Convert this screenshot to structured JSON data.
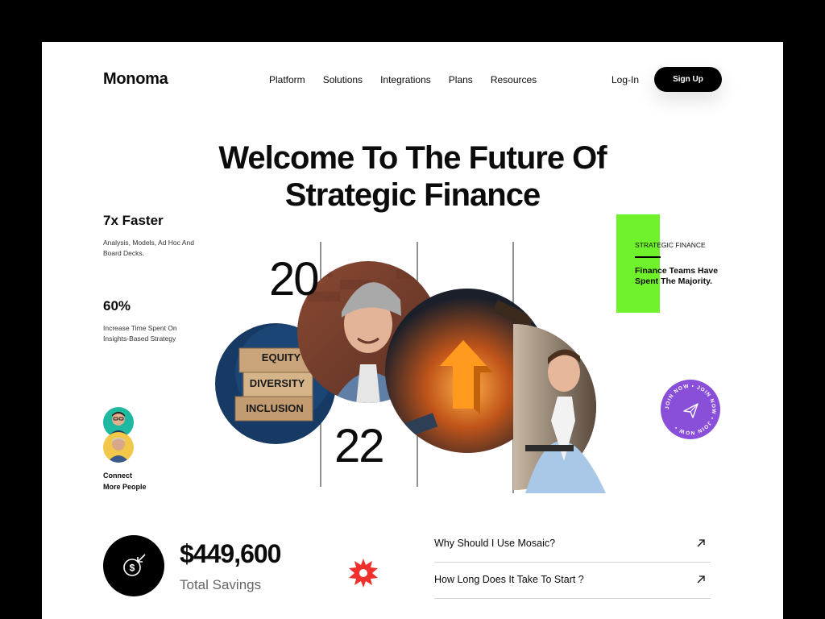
{
  "header": {
    "logo": "Monoma",
    "nav": [
      "Platform",
      "Solutions",
      "Integrations",
      "Plans",
      "Resources"
    ],
    "login": "Log-In",
    "signup": "Sign Up"
  },
  "hero": {
    "line1": "Welcome To The Future Of",
    "line2": "Strategic Finance"
  },
  "stats": [
    {
      "title": "7x Faster",
      "desc": "Analysis, Models, Ad Hoc And Board Decks."
    },
    {
      "title": "60%",
      "desc": "Increase Time Spent On Insights-Based Strategy"
    }
  ],
  "connect": {
    "line1": "Connect",
    "line2": "More People"
  },
  "year": {
    "top": "20",
    "bottom": "22"
  },
  "blocks": {
    "equity": "EQUITY",
    "diversity": "DIVERSITY",
    "inclusion": "INCLUSION"
  },
  "strategic": {
    "label": "STRATEGIC FINANCE",
    "text": "Finance Teams Have Spent The Majority."
  },
  "badge": {
    "ring_text": "JOIN NOW • JOIN NOW • JOIN NOW •"
  },
  "savings": {
    "amount": "$449,600",
    "label": "Total Savings"
  },
  "faq": [
    {
      "question": "Why Should I Use Mosaic?"
    },
    {
      "question": "How Long Does It Take To Start ?"
    }
  ],
  "colors": {
    "accent_green": "#6ff22b",
    "badge_purple": "#8a4fd8",
    "star_red": "#f0302d",
    "avatar1_bg": "#1fb8a0",
    "avatar2_bg": "#f2c84b"
  },
  "icons": [
    "dollar-arrow-icon",
    "send-icon",
    "arrow-up-right-icon",
    "star-burst-icon"
  ]
}
